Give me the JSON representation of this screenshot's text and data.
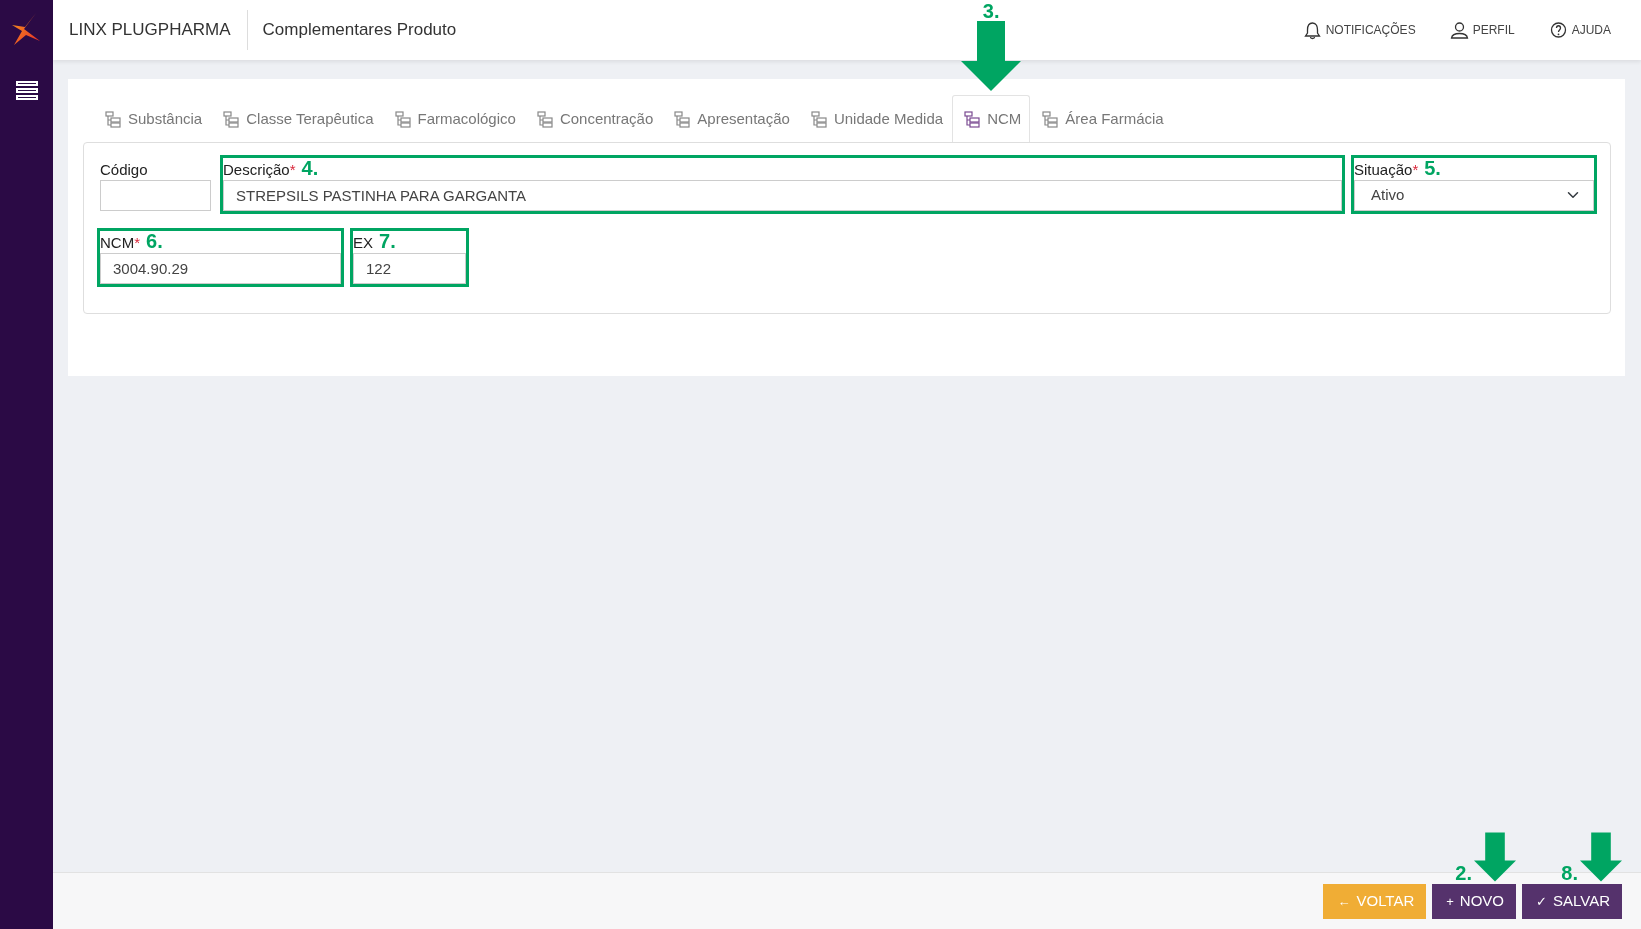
{
  "app": {
    "brand": "LINX PLUGPHARMA",
    "page_title": "Complementares Produto"
  },
  "header_links": [
    {
      "label": "NOTIFICAÇÕES",
      "kind": "bell"
    },
    {
      "label": "PERFIL",
      "kind": "user"
    },
    {
      "label": "AJUDA",
      "kind": "help"
    }
  ],
  "tabs": [
    {
      "label": "Substância",
      "selected": false
    },
    {
      "label": "Classe Terapêutica",
      "selected": false
    },
    {
      "label": "Farmacológico",
      "selected": false
    },
    {
      "label": "Concentração",
      "selected": false
    },
    {
      "label": "Apresentação",
      "selected": false
    },
    {
      "label": "Unidade Medida",
      "selected": false
    },
    {
      "label": "NCM",
      "selected": true,
      "callout": "3."
    },
    {
      "label": "Área Farmácia",
      "selected": false
    }
  ],
  "form": {
    "rows": [
      [
        {
          "label": "Código",
          "kind": "text"
        },
        {
          "label": "Descrição",
          "kind": "text",
          "required_mark": "*",
          "value": "STREPSILS PASTINHA PARA GARGANTA",
          "callout": "4."
        },
        {
          "label": "Situação",
          "kind": "select",
          "required_mark": "*",
          "value": "Ativo",
          "callout": "5."
        }
      ],
      [
        {
          "label": "NCM",
          "kind": "text",
          "required_mark": "*",
          "value": "3004.90.29",
          "callout": "6."
        },
        {
          "label": "EX",
          "kind": "text",
          "value": "122",
          "callout": "7."
        }
      ]
    ]
  },
  "buttons": [
    {
      "label": "VOLTAR",
      "icon": "←",
      "kind": "back"
    },
    {
      "label": "NOVO",
      "icon": "+",
      "kind": "primary",
      "callout": "2."
    },
    {
      "label": "SALVAR",
      "icon": "✓",
      "kind": "primary",
      "callout": "8."
    }
  ]
}
